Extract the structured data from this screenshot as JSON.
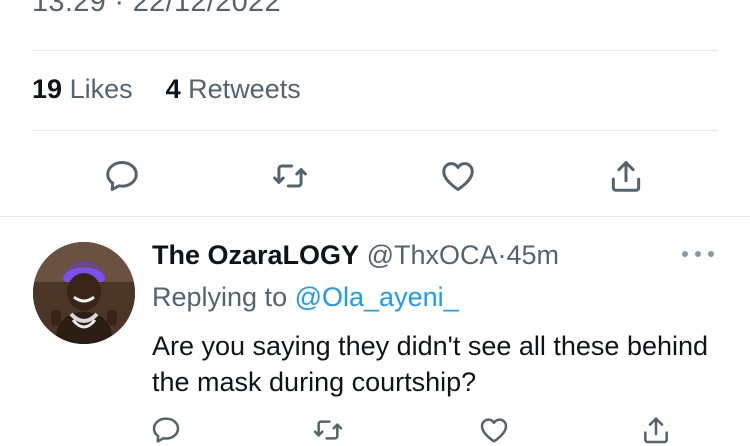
{
  "tweet": {
    "timestamp": "13:29 · 22/12/2022",
    "likes_count": "19",
    "likes_label": "Likes",
    "retweets_count": "4",
    "retweets_label": "Retweets"
  },
  "actions": {
    "icons": [
      "reply-icon",
      "retweet-icon",
      "like-icon",
      "share-icon"
    ],
    "color": "#536471"
  },
  "reply": {
    "display_name": "The OzaraLOGY",
    "handle": "@ThxOCA",
    "separator": "·",
    "time": "45m",
    "replying_prefix": "Replying to",
    "replying_to": "@Ola_ayeni_",
    "text": "Are you saying they didn't see all these behind the mask during courtship?"
  },
  "colors": {
    "link": "#1d9bf0",
    "muted": "#536471",
    "divider": "#e4e8eb"
  }
}
